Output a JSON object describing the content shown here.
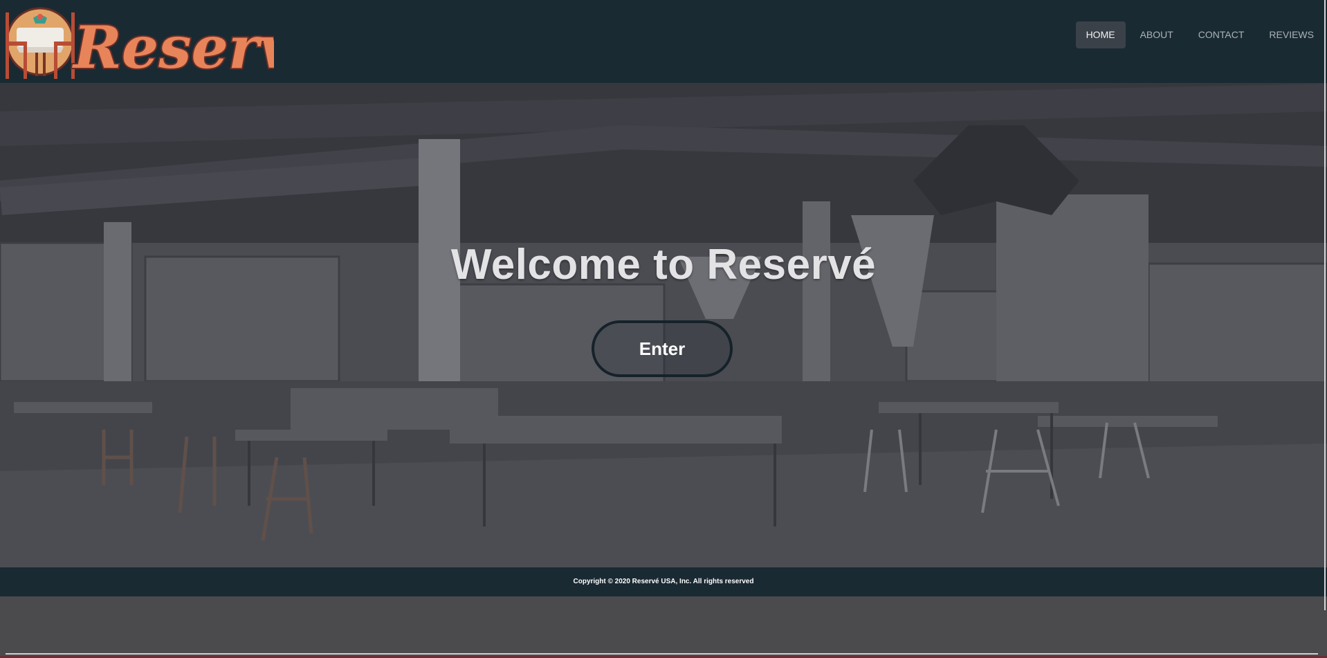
{
  "header": {
    "logo_text": "Reservé",
    "nav": [
      {
        "label": "HOME",
        "active": true
      },
      {
        "label": "ABOUT",
        "active": false
      },
      {
        "label": "CONTACT",
        "active": false
      },
      {
        "label": "REVIEWS",
        "active": false
      }
    ]
  },
  "hero": {
    "title": "Welcome to Reservé",
    "enter_label": "Enter"
  },
  "footer": {
    "copyright": "Copyright © 2020 Reservé USA, Inc. All rights reserved"
  },
  "colors": {
    "header_bg": "#1a2a33",
    "logo_orange": "#e8845a",
    "logo_dark": "#6b2e26",
    "button_border": "#162229",
    "nav_active_bg": "#3a4148"
  },
  "icons": {
    "logo": "restaurant-table-logo-icon"
  }
}
